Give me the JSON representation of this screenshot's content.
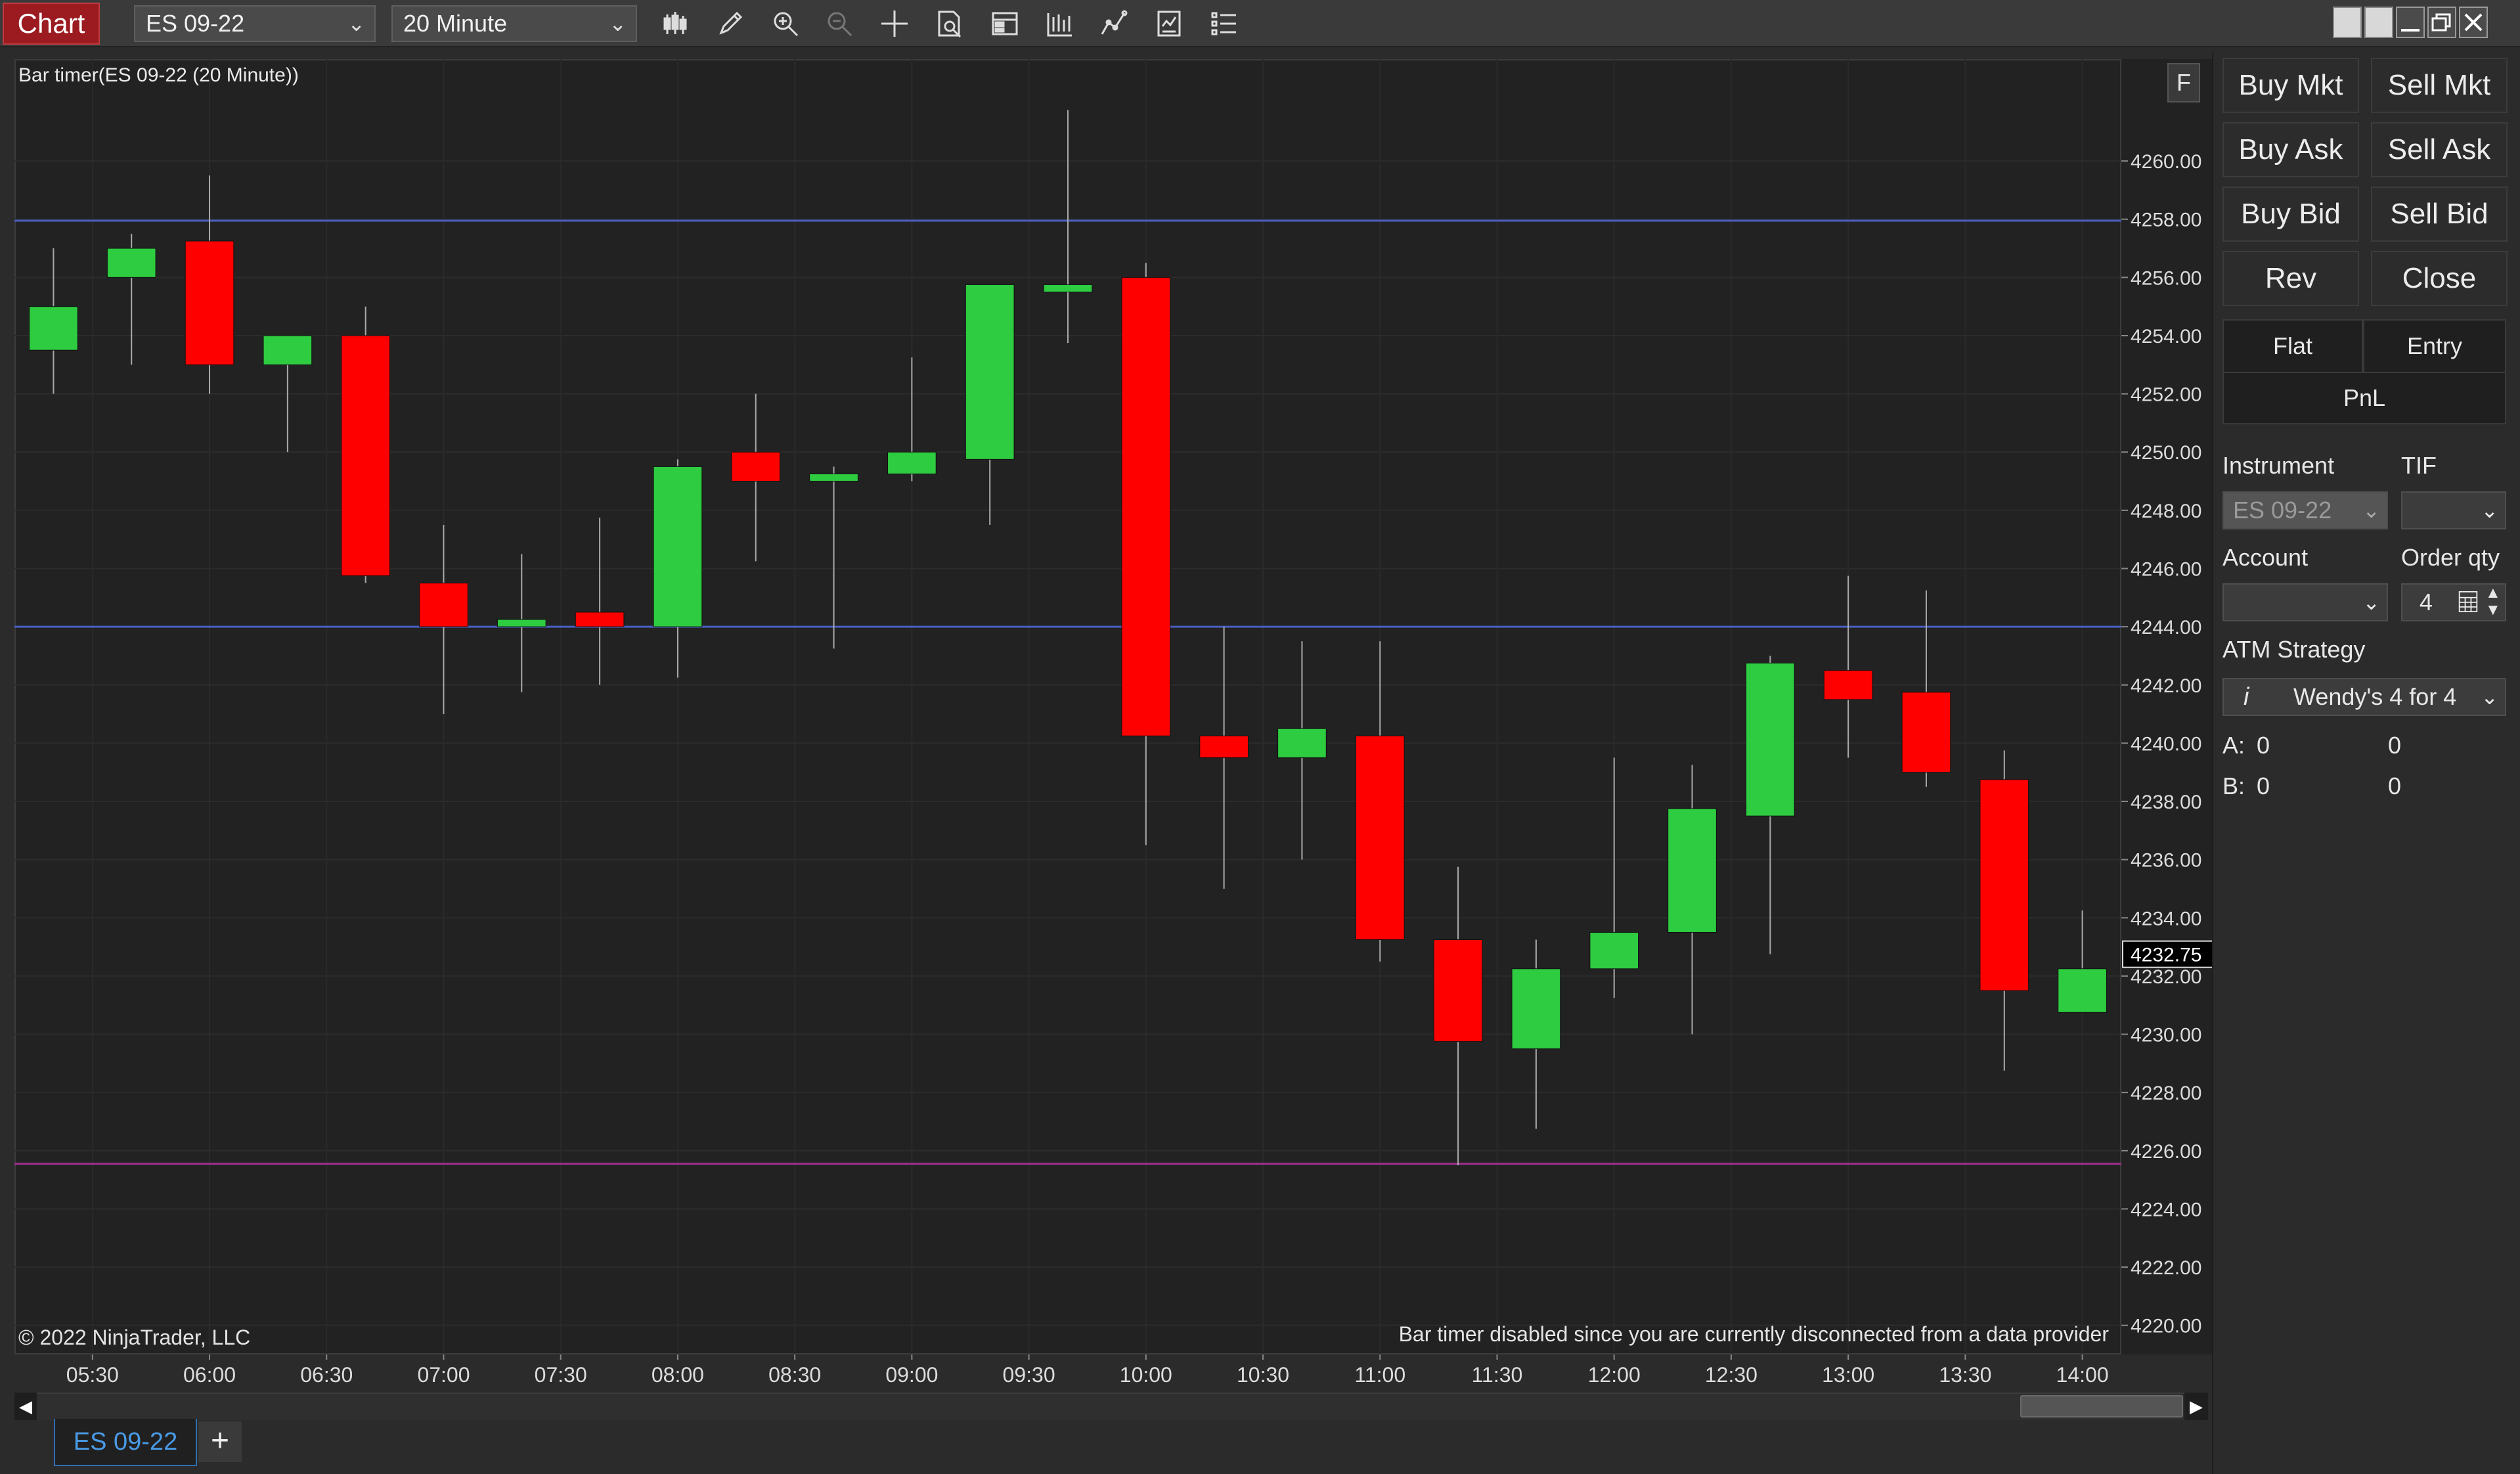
{
  "toolbar": {
    "badge": "Chart",
    "instrument": "ES 09-22",
    "interval": "20 Minute",
    "tools": [
      "bar-style-icon",
      "pencil-icon",
      "zoom-in-icon",
      "zoom-out-icon",
      "crosshair-icon",
      "data-box-icon",
      "properties-icon",
      "indicators-icon",
      "strategies-icon",
      "chart-trader-icon",
      "more-options-icon"
    ]
  },
  "chart": {
    "title": "Bar timer(ES 09-22 (20 Minute))",
    "copyright": "© 2022 NinjaTrader, LLC",
    "message": "Bar timer disabled since you are currently disconnected from a data provider",
    "f_label": "F",
    "last_price": "4232.75"
  },
  "chart_data": {
    "type": "candlestick",
    "y_range": [
      4219,
      4263.5
    ],
    "x_range": [
      0,
      27
    ],
    "y_ticks": [
      "4260.00",
      "4258.00",
      "4256.00",
      "4254.00",
      "4252.00",
      "4250.00",
      "4248.00",
      "4246.00",
      "4244.00",
      "4242.00",
      "4240.00",
      "4238.00",
      "4236.00",
      "4234.00",
      "4232.00",
      "4230.00",
      "4228.00",
      "4226.00",
      "4224.00",
      "4222.00",
      "4220.00"
    ],
    "x_ticks": [
      "05:30",
      "06:00",
      "06:30",
      "07:00",
      "07:30",
      "08:00",
      "08:30",
      "09:00",
      "09:30",
      "10:00",
      "10:30",
      "11:00",
      "11:30",
      "12:00",
      "12:30",
      "13:00",
      "13:30",
      "14:00"
    ],
    "up_color": "#2ecc40",
    "down_color": "#ff0000",
    "bars": [
      {
        "o": 4253.5,
        "h": 4257.0,
        "l": 4252.0,
        "c": 4255.0
      },
      {
        "o": 4256.0,
        "h": 4257.5,
        "l": 4253.0,
        "c": 4257.0
      },
      {
        "o": 4257.25,
        "h": 4259.5,
        "l": 4252.0,
        "c": 4253.0
      },
      {
        "o": 4253.0,
        "h": 4253.75,
        "l": 4250.0,
        "c": 4254.0
      },
      {
        "o": 4254.0,
        "h": 4255.0,
        "l": 4245.5,
        "c": 4245.75
      },
      {
        "o": 4245.5,
        "h": 4247.5,
        "l": 4241.0,
        "c": 4244.0
      },
      {
        "o": 4244.0,
        "h": 4246.5,
        "l": 4241.75,
        "c": 4244.25
      },
      {
        "o": 4244.5,
        "h": 4247.75,
        "l": 4242.0,
        "c": 4244.0
      },
      {
        "o": 4244.0,
        "h": 4249.75,
        "l": 4242.25,
        "c": 4249.5
      },
      {
        "o": 4250.0,
        "h": 4252.0,
        "l": 4246.25,
        "c": 4249.0
      },
      {
        "o": 4249.0,
        "h": 4249.5,
        "l": 4243.25,
        "c": 4249.25
      },
      {
        "o": 4249.25,
        "h": 4253.25,
        "l": 4249.0,
        "c": 4250.0
      },
      {
        "o": 4249.75,
        "h": 4255.75,
        "l": 4247.5,
        "c": 4255.75
      },
      {
        "o": 4255.5,
        "h": 4261.75,
        "l": 4253.75,
        "c": 4255.75
      },
      {
        "o": 4256.0,
        "h": 4256.5,
        "l": 4236.5,
        "c": 4240.25
      },
      {
        "o": 4240.25,
        "h": 4244.0,
        "l": 4235.0,
        "c": 4239.5
      },
      {
        "o": 4239.5,
        "h": 4243.5,
        "l": 4236.0,
        "c": 4240.5
      },
      {
        "o": 4240.25,
        "h": 4243.5,
        "l": 4232.5,
        "c": 4233.25
      },
      {
        "o": 4233.25,
        "h": 4235.75,
        "l": 4225.5,
        "c": 4229.75
      },
      {
        "o": 4229.5,
        "h": 4233.25,
        "l": 4226.75,
        "c": 4232.25
      },
      {
        "o": 4232.25,
        "h": 4239.5,
        "l": 4231.25,
        "c": 4233.5
      },
      {
        "o": 4233.5,
        "h": 4239.25,
        "l": 4230.0,
        "c": 4237.75
      },
      {
        "o": 4237.5,
        "h": 4243.0,
        "l": 4232.75,
        "c": 4242.75
      },
      {
        "o": 4242.5,
        "h": 4245.75,
        "l": 4239.5,
        "c": 4241.5
      },
      {
        "o": 4241.75,
        "h": 4245.25,
        "l": 4238.5,
        "c": 4239.0
      },
      {
        "o": 4238.75,
        "h": 4239.75,
        "l": 4228.75,
        "c": 4231.5
      },
      {
        "o": 4230.75,
        "h": 4234.25,
        "l": 4230.75,
        "c": 4232.25
      }
    ],
    "bar_x": [
      0.5,
      1.5,
      2.5,
      3.5,
      4.5,
      5.5,
      6.5,
      7.5,
      8.5,
      9.5,
      10.5,
      11.5,
      12.5,
      13.5,
      14.5,
      15.5,
      16.5,
      17.5,
      18.5,
      19.5,
      20.5,
      21.5,
      22.5,
      23.5,
      24.5,
      25.5,
      26.5
    ],
    "horizontal_lines": [
      {
        "price": 4257.95,
        "color": "#4a5fbf"
      },
      {
        "price": 4244.0,
        "color": "#4a5fbf"
      },
      {
        "price": 4225.55,
        "color": "#a0308f"
      }
    ]
  },
  "tabs": {
    "active": "ES 09-22",
    "add": "+"
  },
  "panel": {
    "buy_mkt": "Buy Mkt",
    "sell_mkt": "Sell Mkt",
    "buy_ask": "Buy Ask",
    "sell_ask": "Sell Ask",
    "buy_bid": "Buy Bid",
    "sell_bid": "Sell Bid",
    "rev": "Rev",
    "close": "Close",
    "flat": "Flat",
    "entry": "Entry",
    "pnl": "PnL",
    "instrument_label": "Instrument",
    "instrument_value": "ES 09-22",
    "tif_label": "TIF",
    "account_label": "Account",
    "order_qty_label": "Order qty",
    "order_qty_value": "4",
    "atm_label": "ATM Strategy",
    "atm_value": "Wendy's 4 for 4",
    "a_label": "A:",
    "a_val1": "0",
    "a_val2": "0",
    "b_label": "B:",
    "b_val1": "0",
    "b_val2": "0"
  }
}
